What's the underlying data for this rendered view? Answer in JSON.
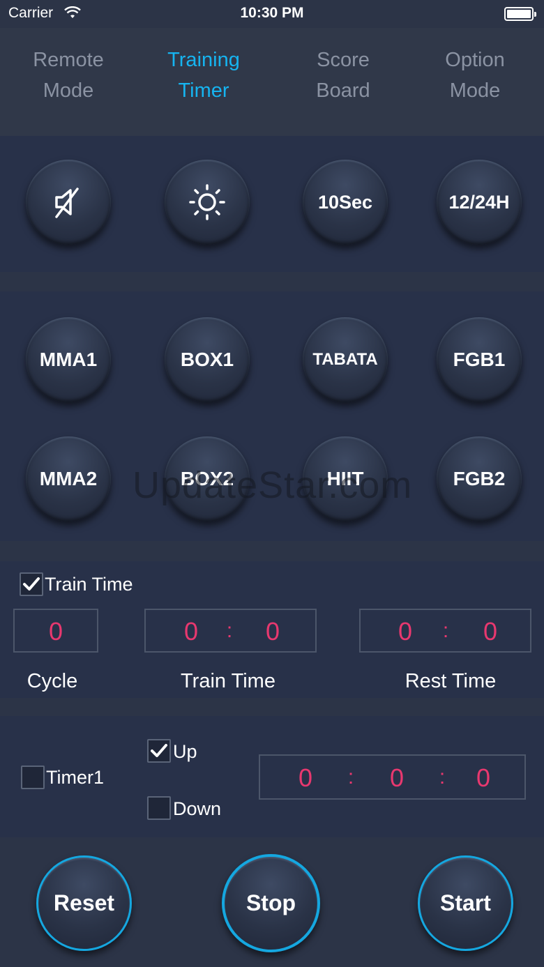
{
  "status_bar": {
    "carrier": "Carrier",
    "time": "10:30 PM",
    "wifi_icon": "wifi-icon",
    "battery_icon": "battery-icon"
  },
  "tabs": [
    {
      "line1": "Remote",
      "line2": "Mode",
      "active": false
    },
    {
      "line1": "Training",
      "line2": "Timer",
      "active": true
    },
    {
      "line1": "Score",
      "line2": "Board",
      "active": false
    },
    {
      "line1": "Option",
      "line2": "Mode",
      "active": false
    }
  ],
  "settings_buttons": {
    "mute_icon": "mute-icon",
    "brightness_icon": "brightness-icon",
    "ten_sec": "10Sec",
    "hour_format": "12/24H"
  },
  "presets": {
    "row1": [
      "MMA1",
      "BOX1",
      "TABATA",
      "FGB1"
    ],
    "row2": [
      "MMA2",
      "BOX2",
      "HIIT",
      "FGB2"
    ]
  },
  "watermark": "UpdateStar.com",
  "train": {
    "checkbox_label": "Train Time",
    "checked": true,
    "cycle_value": "0",
    "train_min": "0",
    "train_sec": "0",
    "rest_min": "0",
    "rest_sec": "0",
    "colon": ":",
    "labels": {
      "cycle": "Cycle",
      "train_time": "Train Time",
      "rest_time": "Rest Time"
    }
  },
  "timer": {
    "timer1_label": "Timer1",
    "timer1_checked": false,
    "up_label": "Up",
    "up_checked": true,
    "down_label": "Down",
    "down_checked": false,
    "hours": "0",
    "minutes": "0",
    "seconds": "0",
    "colon": ":"
  },
  "controls": {
    "reset": "Reset",
    "stop": "Stop",
    "start": "Start"
  },
  "colors": {
    "background": "#2c3447",
    "panel": "#283149",
    "active_tab": "#16b4f0",
    "inactive_tab": "#8b93a3",
    "digit": "#e8386f",
    "control_ring": "#15a7e0"
  }
}
